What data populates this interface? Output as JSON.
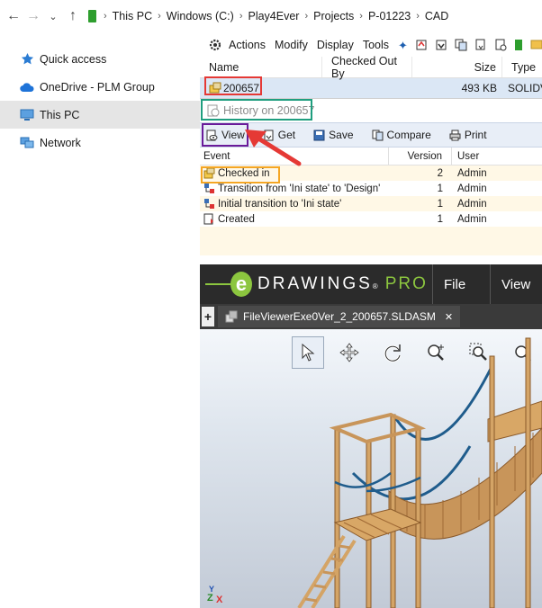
{
  "address": {
    "crumbs": [
      "This PC",
      "Windows (C:)",
      "Play4Ever",
      "Projects",
      "P-01223",
      "CAD"
    ]
  },
  "nav": {
    "items": [
      {
        "label": "Quick access",
        "icon": "star-icon"
      },
      {
        "label": "OneDrive - PLM Group",
        "icon": "cloud-icon"
      },
      {
        "label": "This PC",
        "icon": "computer-icon"
      },
      {
        "label": "Network",
        "icon": "network-icon"
      }
    ]
  },
  "menubar": {
    "items": [
      "Actions",
      "Modify",
      "Display",
      "Tools"
    ]
  },
  "columns": {
    "name": "Name",
    "checked_out_by": "Checked Out By",
    "size": "Size",
    "type": "Type"
  },
  "file": {
    "name": "200657",
    "size": "493 KB",
    "type": "SOLIDV"
  },
  "history": {
    "title": "History on 200657",
    "toolbar": [
      "View",
      "Get",
      "Save",
      "Compare",
      "Print"
    ],
    "headers": {
      "event": "Event",
      "version": "Version",
      "user": "User"
    },
    "rows": [
      {
        "event": "Checked in",
        "version": "2",
        "user": "Admin"
      },
      {
        "event": "Transition from 'Ini state' to 'Design'",
        "version": "1",
        "user": "Admin"
      },
      {
        "event": "Initial transition to 'Ini state'",
        "version": "1",
        "user": "Admin"
      },
      {
        "event": "Created",
        "version": "1",
        "user": "Admin"
      }
    ]
  },
  "edrawings": {
    "logo_word": "DRAWINGS",
    "logo_reg": "®",
    "logo_pro": "PRO",
    "menu": [
      "File",
      "View"
    ],
    "tab_label": "FileViewerExe0Ver_2_200657.SLDASM",
    "tab_close": "✕",
    "plus": "+"
  },
  "colors": {
    "annotation_red": "#e53935",
    "annotation_teal": "#1f9e7f",
    "annotation_purple": "#6a1b9a",
    "annotation_orange": "#f5a623",
    "edrawings_green": "#8cc63f"
  }
}
